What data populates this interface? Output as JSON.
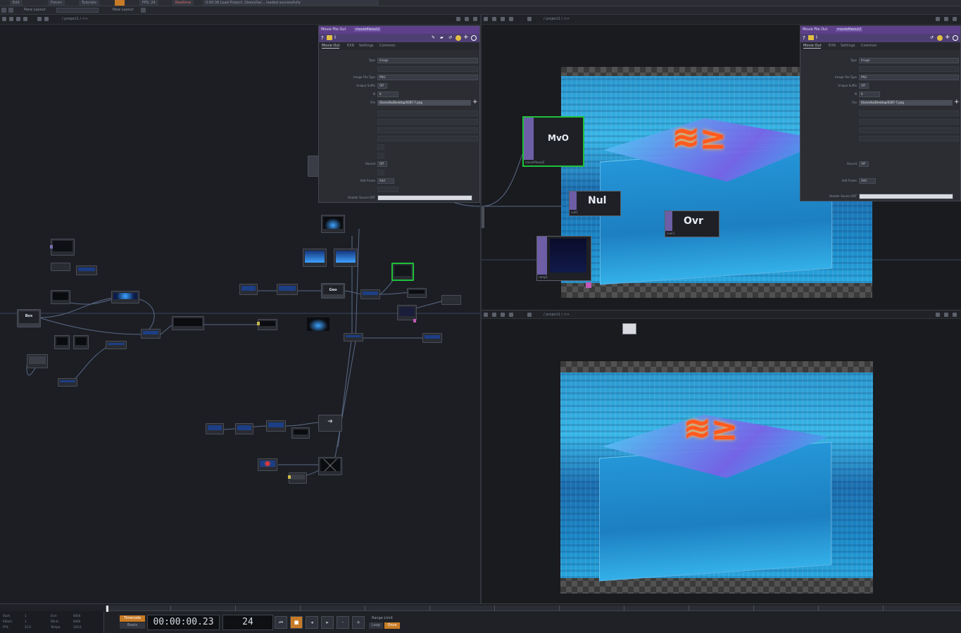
{
  "menubar": {
    "items": [
      "Edit",
      "Forum",
      "Tutorials",
      "FPS: 24"
    ],
    "realtime_label": "Realtime",
    "status_message": "0:00:38 Load Project: /Users/lia/... loaded successfully"
  },
  "layoutbar": {
    "left_label": "Pane Layout",
    "right_label": "New Layout"
  },
  "panes": {
    "network_path": "/ project1 / >>",
    "viewer_top_path": "/ project1 / >>",
    "viewer_bottom_path": "/ project1 / >>"
  },
  "param_panel": {
    "header_type": "Movie File Out",
    "header_name": "moviefileout2",
    "tabs": [
      "Movie Out",
      "EXR",
      "Settings",
      "Common"
    ],
    "rows": [
      {
        "label": "Type",
        "value": "Image"
      },
      {
        "label": "Image File Type",
        "value": "PNG"
      },
      {
        "label": "Unique Suffix",
        "value": "Off"
      },
      {
        "label": "N",
        "value": "8"
      },
      {
        "label": "File",
        "value": "/Users/lia/Desktop/0287-7.png"
      },
      {
        "label": "Record",
        "value": "Off"
      },
      {
        "label": "Add Frame",
        "value": "Add"
      },
      {
        "label": "Header Source DAT",
        "value": ""
      }
    ]
  },
  "viewer_nodes": {
    "mvo": {
      "title": "MvO",
      "name": "moviefileout2"
    },
    "nul": {
      "title": "Nul",
      "name": "null1"
    },
    "ovr": {
      "title": "Ovr",
      "name": "over1"
    },
    "ramp": {
      "name": "ramp1"
    }
  },
  "network_nodes": [
    {
      "label": "Box"
    },
    {
      "label": "Geo"
    },
    {
      "label": "null1"
    }
  ],
  "timeline": {
    "timecode_label": "Timecode",
    "beats_label": "Beats",
    "timecode": "00:00:00.23",
    "frame": "24",
    "range_label": "Range Limit",
    "loop_label": "Loop",
    "once_label": "Once",
    "stats": [
      {
        "k": "Start:",
        "v": "1"
      },
      {
        "k": "End:",
        "v": "6000"
      },
      {
        "k": "RStart:",
        "v": "1"
      },
      {
        "k": "REnd:",
        "v": "6000"
      },
      {
        "k": "FPS:",
        "v": "25.0"
      },
      {
        "k": "Tempo:",
        "v": "120.0"
      }
    ]
  }
}
